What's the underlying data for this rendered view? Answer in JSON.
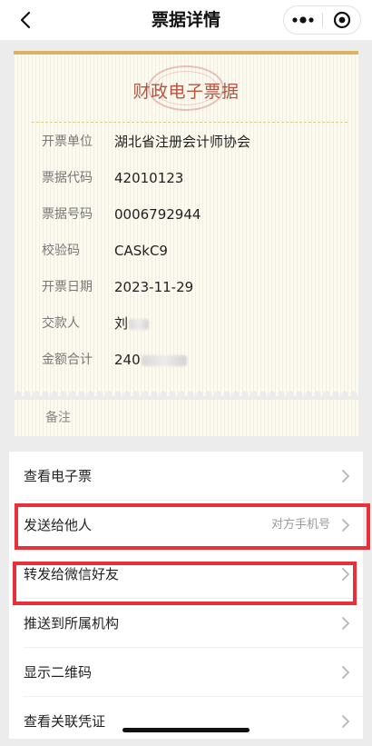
{
  "nav": {
    "title": "票据详情"
  },
  "receipt": {
    "title": "财政电子票据",
    "fields": [
      {
        "label": "开票单位",
        "value": "湖北省注册会计师协会"
      },
      {
        "label": "票据代码",
        "value": "42010123"
      },
      {
        "label": "票据号码",
        "value": "0006792944"
      },
      {
        "label": "校验码",
        "value": "CASkC9"
      },
      {
        "label": "开票日期",
        "value": "2023-11-29"
      },
      {
        "label": "交款人",
        "value": "刘"
      },
      {
        "label": "金额合计",
        "value": "240"
      }
    ],
    "remarks_label": "备注"
  },
  "actions": [
    {
      "label": "查看电子票",
      "hint": ""
    },
    {
      "label": "发送给他人",
      "hint": "对方手机号"
    },
    {
      "label": "转发给微信好友",
      "hint": ""
    },
    {
      "label": "推送到所属机构",
      "hint": ""
    },
    {
      "label": "显示二维码",
      "hint": ""
    },
    {
      "label": "查看关联凭证",
      "hint": ""
    }
  ],
  "colors": {
    "accent_gold": "#d9b466",
    "title_red": "#b5553f",
    "highlight_red": "#e8303a"
  },
  "icons": {
    "back": "chevron-left-icon",
    "more": "more-dots-icon",
    "close": "target-close-icon",
    "row": "chevron-right-icon"
  }
}
